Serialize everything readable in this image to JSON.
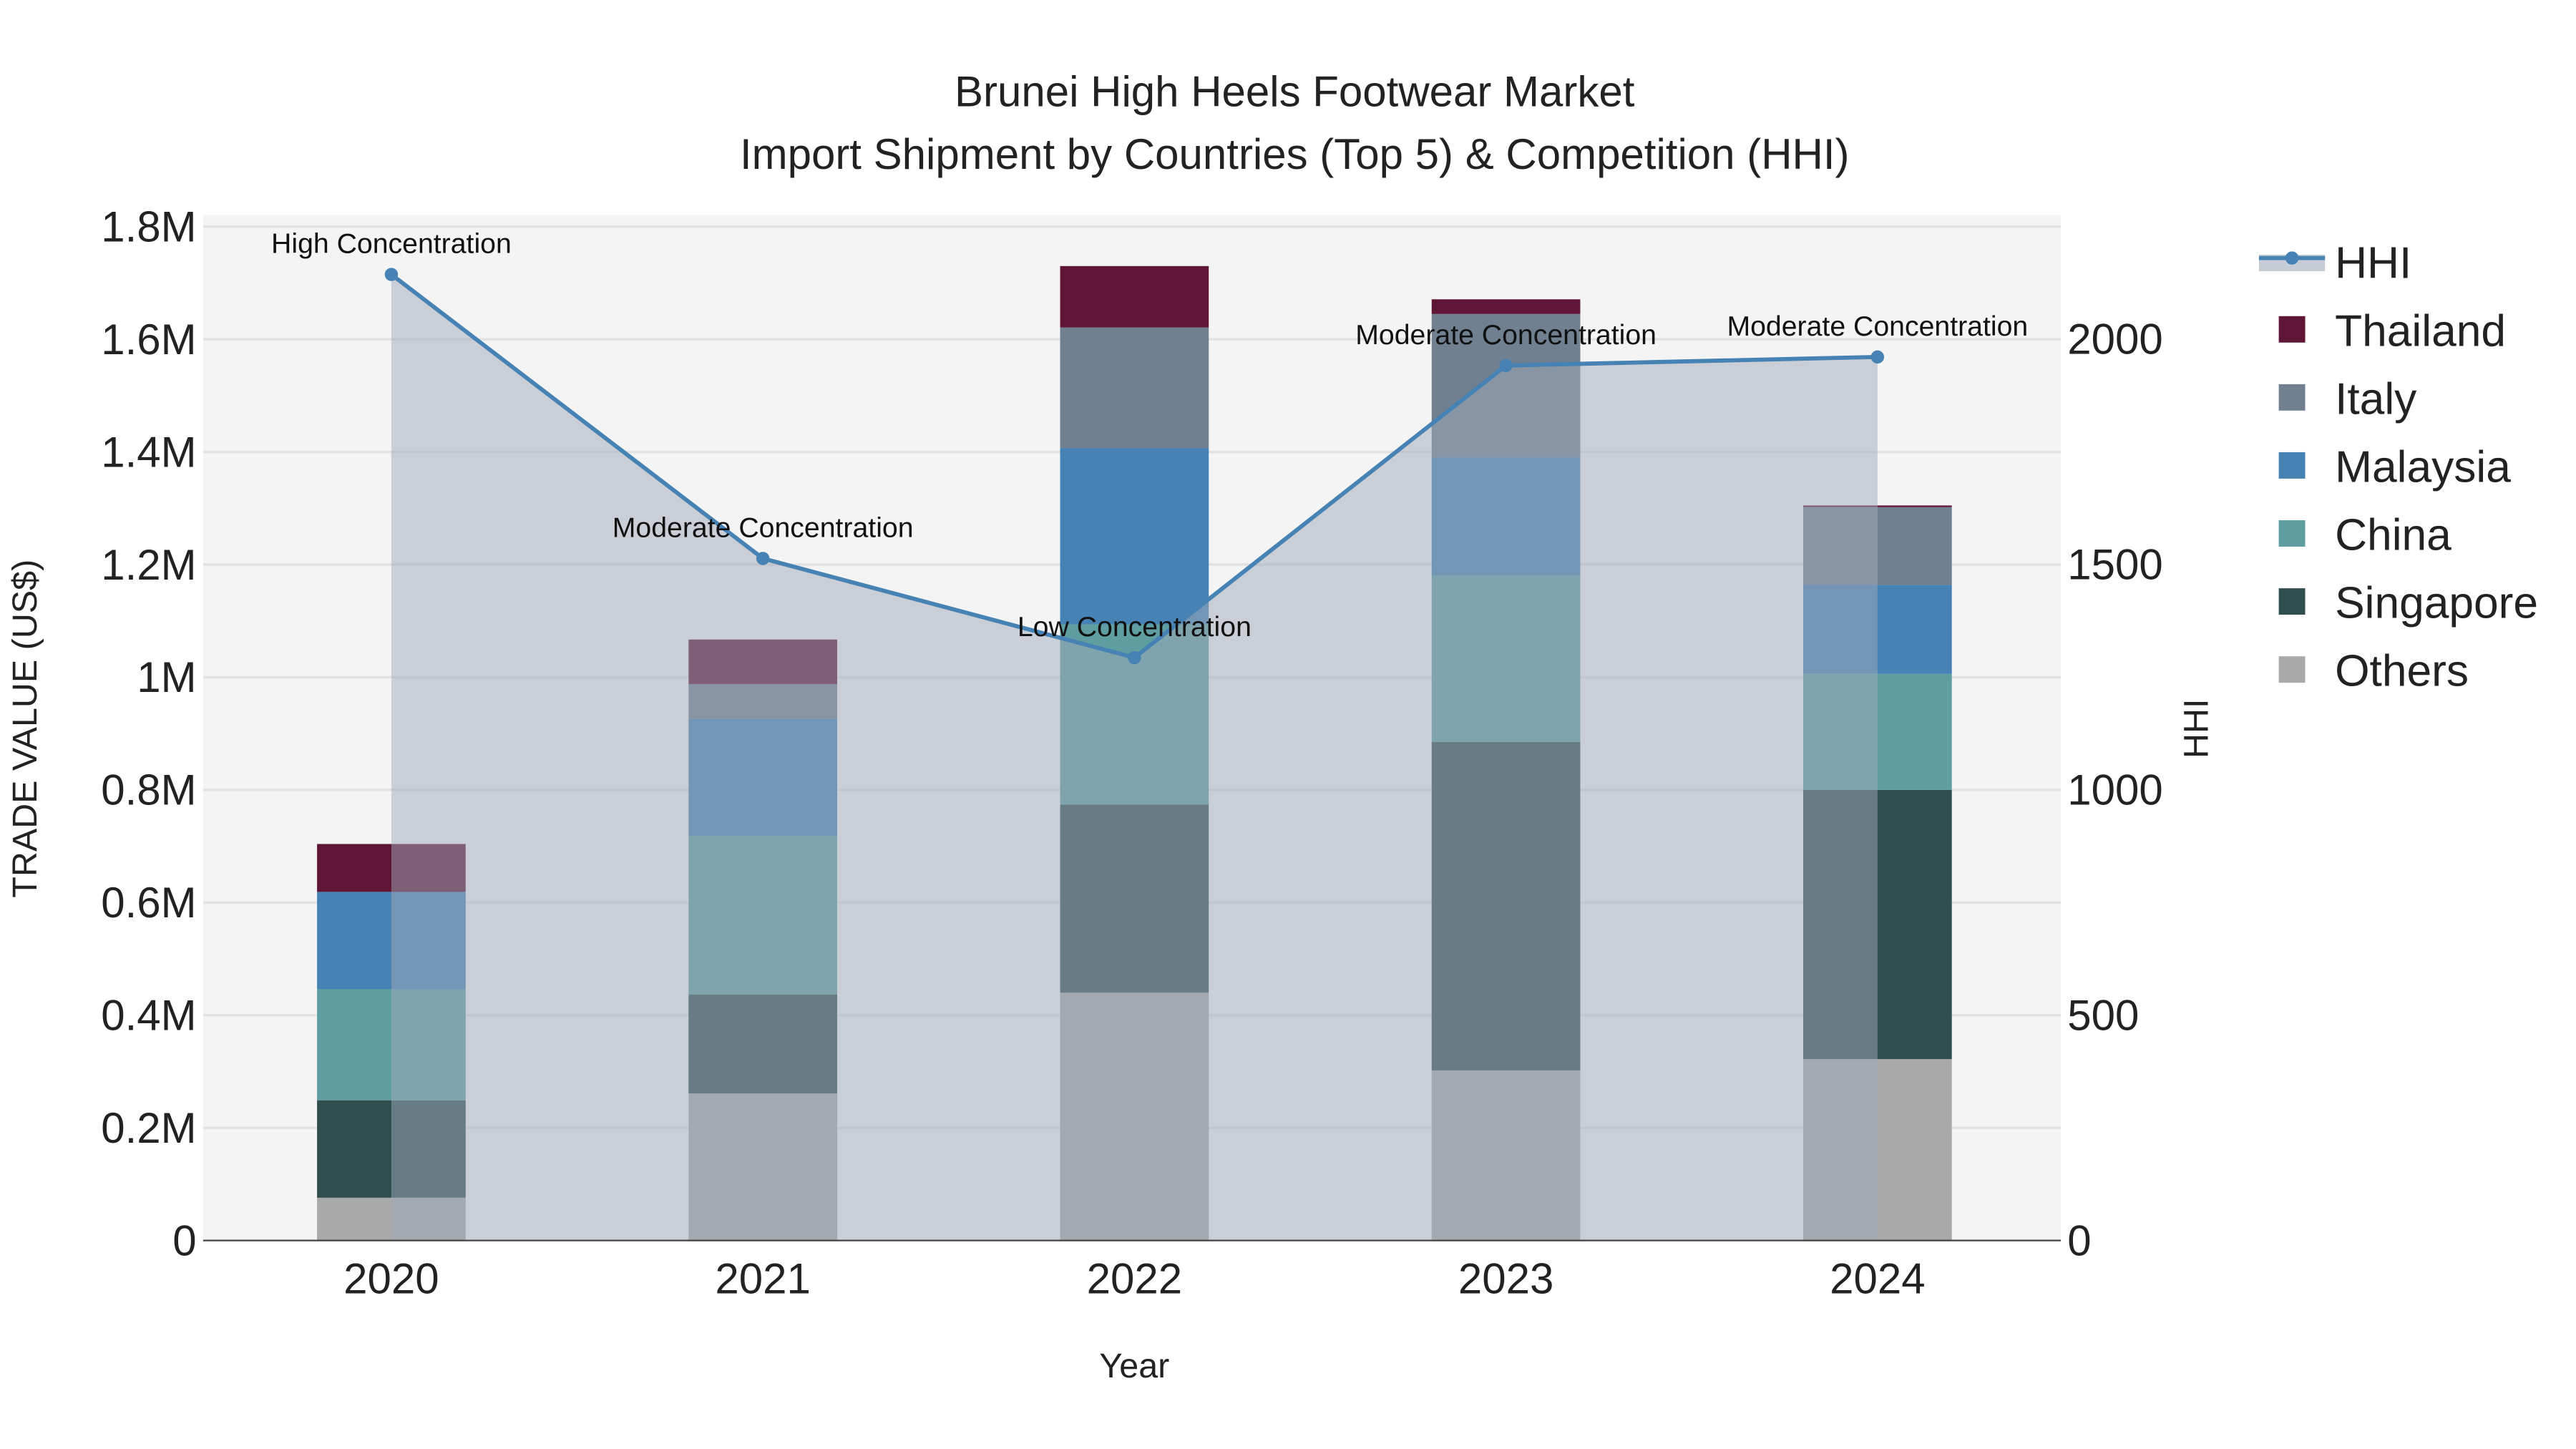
{
  "chart_data": {
    "type": "bar",
    "title_line1": "Brunei High Heels Footwear Market",
    "title_line2": "Import Shipment by Countries (Top 5) & Competition (HHI)",
    "xlabel": "Year",
    "ylabel": "TRADE VALUE (US$)",
    "y2label": "HHI",
    "categories": [
      "2020",
      "2021",
      "2022",
      "2023",
      "2024"
    ],
    "ylim": [
      0,
      1800000
    ],
    "y2lim": [
      0,
      2275
    ],
    "yticks": [
      0,
      200000,
      400000,
      600000,
      800000,
      1000000,
      1200000,
      1400000,
      1600000,
      1800000
    ],
    "ytick_labels": [
      "0",
      "0.2M",
      "0.4M",
      "0.6M",
      "0.8M",
      "1M",
      "1.2M",
      "1.4M",
      "1.6M",
      "1.8M"
    ],
    "y2ticks": [
      0,
      500,
      1000,
      1500,
      2000
    ],
    "y2tick_labels": [
      "0",
      "500",
      "1000",
      "1500",
      "2000"
    ],
    "grid": true,
    "legend_position": "right",
    "series": [
      {
        "name": "Others",
        "color": "#a9a9a9",
        "values": [
          76000,
          261000,
          440000,
          302000,
          322000
        ]
      },
      {
        "name": "Singapore",
        "color": "#2f4f4f",
        "values": [
          173000,
          176000,
          334000,
          583000,
          478000
        ]
      },
      {
        "name": "China",
        "color": "#5f9ea0",
        "values": [
          197000,
          281000,
          320000,
          296000,
          206000
        ]
      },
      {
        "name": "Malaysia",
        "color": "#4682b4",
        "values": [
          173000,
          208000,
          313000,
          209000,
          158000
        ]
      },
      {
        "name": "Italy",
        "color": "#708090",
        "values": [
          0,
          62000,
          214000,
          255000,
          138000
        ]
      },
      {
        "name": "Thailand",
        "color": "#5f1536",
        "values": [
          85000,
          79000,
          109000,
          26000,
          3000
        ]
      }
    ],
    "hhi": {
      "name": "HHI",
      "color": "#4682b4",
      "values": [
        2143,
        1513,
        1293,
        1941,
        1960
      ],
      "annotations": [
        "High Concentration",
        "Moderate Concentration",
        "Low Concentration",
        "Moderate Concentration",
        "Moderate Concentration"
      ]
    },
    "legend_order": [
      "HHI",
      "Thailand",
      "Italy",
      "Malaysia",
      "China",
      "Singapore",
      "Others"
    ]
  }
}
